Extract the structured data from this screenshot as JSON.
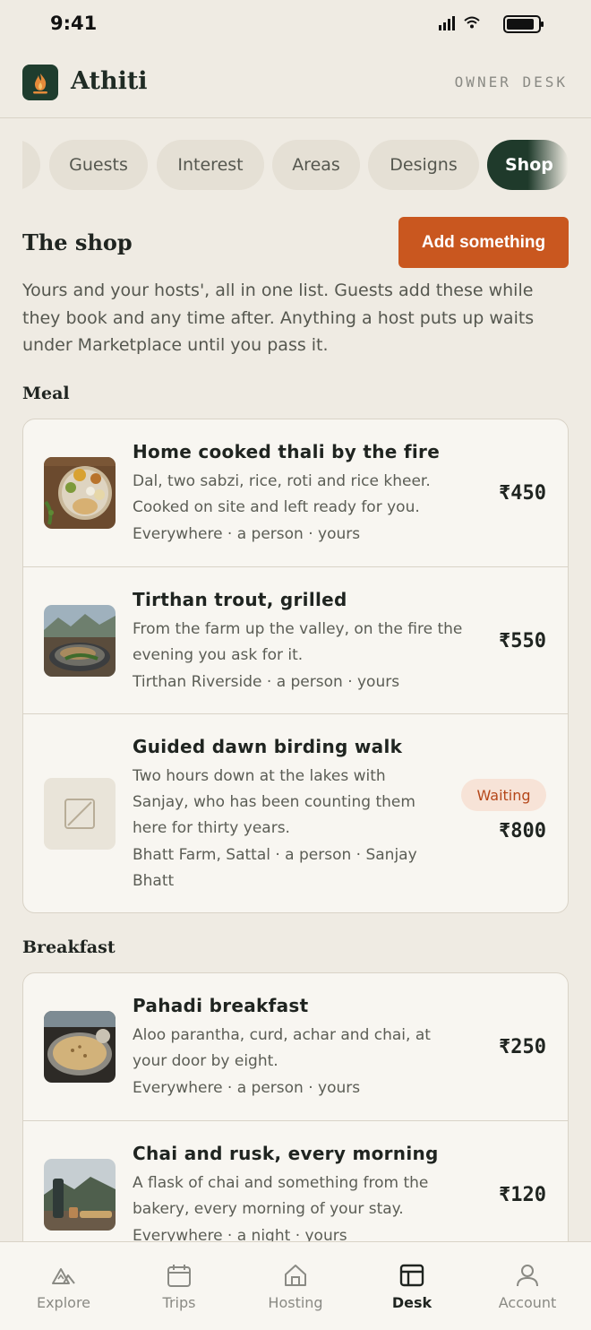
{
  "status_bar": {
    "time": "9:41"
  },
  "header": {
    "title": "Athiti",
    "owner_desk": "OWNER DESK"
  },
  "tabs": [
    {
      "label": ""
    },
    {
      "label": "Guests"
    },
    {
      "label": "Interest"
    },
    {
      "label": "Areas"
    },
    {
      "label": "Designs"
    },
    {
      "label": "Shop"
    }
  ],
  "shop": {
    "title": "The shop",
    "add_label": "Add something",
    "intro": "Yours and your hosts', all in one list. Guests add these while they book and any time after. Anything a host puts up waits under Marketplace until you pass it."
  },
  "groups": {
    "meal": {
      "label": "Meal",
      "items": [
        {
          "title": "Home cooked thali by the fire",
          "desc": "Dal, two sabzi, rice, roti and rice kheer. Cooked on site and left ready for you.",
          "meta": "Everywhere · a person · yours",
          "price": "₹450"
        },
        {
          "title": "Tirthan trout, grilled",
          "desc": "From the farm up the valley, on the fire the evening you ask for it.",
          "meta": "Tirthan Riverside · a person · yours",
          "price": "₹550"
        },
        {
          "title": "Guided dawn birding walk",
          "desc": "Two hours down at the lakes with Sanjay, who has been counting them here for thirty years.",
          "meta": "Bhatt Farm, Sattal · a person · Sanjay Bhatt",
          "price": "₹800",
          "badge": "Waiting"
        }
      ]
    },
    "breakfast": {
      "label": "Breakfast",
      "items": [
        {
          "title": "Pahadi breakfast",
          "desc": "Aloo parantha, curd, achar and chai, at your door by eight.",
          "meta": "Everywhere · a person · yours",
          "price": "₹250"
        },
        {
          "title": "Chai and rusk, every morning",
          "desc": "A flask of chai and something from the bakery, every morning of your stay.",
          "meta": "Everywhere · a night · yours",
          "price": "₹120"
        }
      ]
    }
  },
  "nav": [
    {
      "label": "Explore",
      "icon": "mountain-icon"
    },
    {
      "label": "Trips",
      "icon": "calendar-icon"
    },
    {
      "label": "Hosting",
      "icon": "home-icon"
    },
    {
      "label": "Desk",
      "icon": "desk-icon",
      "active": true
    },
    {
      "label": "Account",
      "icon": "person-icon"
    }
  ],
  "colors": {
    "background": "#efebe3",
    "accent": "#c9571f",
    "brand_green": "#1f3a2b",
    "badge_bg": "#f7e3d7",
    "badge_text": "#b5471a"
  }
}
